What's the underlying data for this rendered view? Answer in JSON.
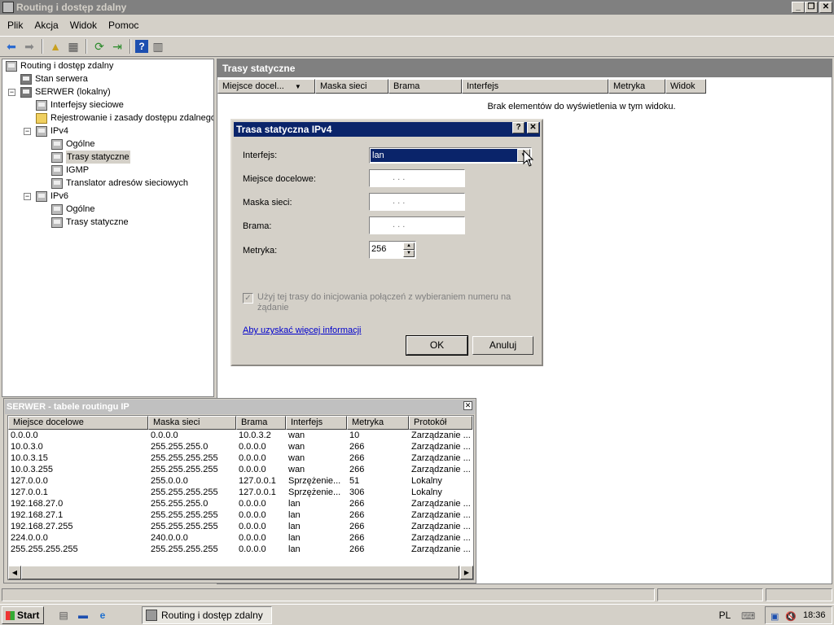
{
  "window": {
    "title": "Routing i dostęp zdalny"
  },
  "menu": [
    "Plik",
    "Akcja",
    "Widok",
    "Pomoc"
  ],
  "tree": [
    {
      "label": "Routing i dostęp zdalny",
      "name": "tree-root"
    },
    {
      "label": "Stan serwera",
      "name": "tree-server-status"
    },
    {
      "label": "SERWER (lokalny)",
      "name": "tree-server-local"
    },
    {
      "label": "Interfejsy sieciowe",
      "name": "tree-network-interfaces"
    },
    {
      "label": "Rejestrowanie i zasady dostępu zdalnego",
      "name": "tree-remote-access-logging"
    },
    {
      "label": "IPv4",
      "name": "tree-ipv4"
    },
    {
      "label": "Ogólne",
      "name": "tree-ipv4-general"
    },
    {
      "label": "Trasy statyczne",
      "name": "tree-ipv4-static-routes"
    },
    {
      "label": "IGMP",
      "name": "tree-igmp"
    },
    {
      "label": "Translator adresów sieciowych",
      "name": "tree-nat"
    },
    {
      "label": "IPv6",
      "name": "tree-ipv6"
    },
    {
      "label": "Ogólne",
      "name": "tree-ipv6-general"
    },
    {
      "label": "Trasy statyczne",
      "name": "tree-ipv6-static-routes"
    }
  ],
  "right_pane": {
    "title": "Trasy statyczne",
    "columns": [
      "Miejsce docel...",
      "Maska sieci",
      "Brama",
      "Interfejs",
      "Metryka",
      "Widok"
    ],
    "empty_text": "Brak elementów do wyświetlenia w tym widoku."
  },
  "dialog": {
    "title": "Trasa statyczna IPv4",
    "help": "?",
    "close": "✕",
    "interface_label": "Interfejs:",
    "interface_value": "lan",
    "destination_label": "Miejsce docelowe:",
    "mask_label": "Maska sieci:",
    "gateway_label": "Brama:",
    "metric_label": "Metryka:",
    "metric_value": "256",
    "ip_placeholder": ".     .     .",
    "checkbox_label": "Użyj tej trasy do inicjowania połączeń z wybieraniem numeru na żądanie",
    "link": "Aby uzyskać więcej informacji",
    "ok": "OK",
    "cancel": "Anuluj"
  },
  "routes_window": {
    "title": "SERWER - tabele routingu IP",
    "columns": [
      "Miejsce docelowe",
      "Maska sieci",
      "Brama",
      "Interfejs",
      "Metryka",
      "Protokół"
    ],
    "rows": [
      [
        "0.0.0.0",
        "0.0.0.0",
        "10.0.3.2",
        "wan",
        "10",
        "Zarządzanie ..."
      ],
      [
        "10.0.3.0",
        "255.255.255.0",
        "0.0.0.0",
        "wan",
        "266",
        "Zarządzanie ..."
      ],
      [
        "10.0.3.15",
        "255.255.255.255",
        "0.0.0.0",
        "wan",
        "266",
        "Zarządzanie ..."
      ],
      [
        "10.0.3.255",
        "255.255.255.255",
        "0.0.0.0",
        "wan",
        "266",
        "Zarządzanie ..."
      ],
      [
        "127.0.0.0",
        "255.0.0.0",
        "127.0.0.1",
        "Sprzężenie...",
        "51",
        "Lokalny"
      ],
      [
        "127.0.0.1",
        "255.255.255.255",
        "127.0.0.1",
        "Sprzężenie...",
        "306",
        "Lokalny"
      ],
      [
        "192.168.27.0",
        "255.255.255.0",
        "0.0.0.0",
        "lan",
        "266",
        "Zarządzanie ..."
      ],
      [
        "192.168.27.1",
        "255.255.255.255",
        "0.0.0.0",
        "lan",
        "266",
        "Zarządzanie ..."
      ],
      [
        "192.168.27.255",
        "255.255.255.255",
        "0.0.0.0",
        "lan",
        "266",
        "Zarządzanie ..."
      ],
      [
        "224.0.0.0",
        "240.0.0.0",
        "0.0.0.0",
        "lan",
        "266",
        "Zarządzanie ..."
      ],
      [
        "255.255.255.255",
        "255.255.255.255",
        "0.0.0.0",
        "lan",
        "266",
        "Zarządzanie ..."
      ]
    ]
  },
  "taskbar": {
    "start": "Start",
    "task": "Routing i dostęp zdalny",
    "lang": "PL",
    "clock": "18:36"
  }
}
